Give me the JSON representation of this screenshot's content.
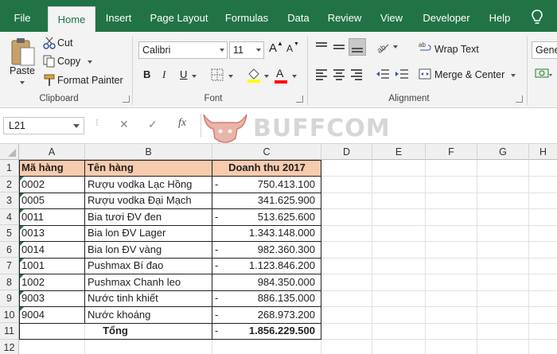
{
  "ribbon_tabs": [
    "File",
    "Home",
    "Insert",
    "Page Layout",
    "Formulas",
    "Data",
    "Review",
    "View",
    "Developer",
    "Help"
  ],
  "clipboard": {
    "paste": "Paste",
    "cut": "Cut",
    "copy": "Copy",
    "format_painter": "Format Painter",
    "label": "Clipboard"
  },
  "font": {
    "name": "Calibri",
    "size": "11",
    "bold": "B",
    "italic": "I",
    "underline": "U",
    "grow": "A",
    "shrink": "A",
    "font_color_letter": "A",
    "label": "Font",
    "fill_color": "#ffff00",
    "font_color": "#ff0000"
  },
  "alignment": {
    "wrap_text": "Wrap Text",
    "merge_center": "Merge & Center",
    "label": "Alignment"
  },
  "number": {
    "format": "Gene"
  },
  "formula_bar": {
    "name_box": "L21",
    "cancel": "✕",
    "enter": "✓",
    "fx": "fx",
    "value": ""
  },
  "watermark": {
    "text": "BUFFCOM"
  },
  "sheet": {
    "columns": [
      "A",
      "B",
      "C",
      "D",
      "E",
      "F",
      "G",
      "H"
    ],
    "rows": [
      "1",
      "2",
      "3",
      "4",
      "5",
      "6",
      "7",
      "8",
      "9",
      "10",
      "11",
      "12"
    ],
    "header": {
      "a": "Mã hàng",
      "b": "Tên hàng",
      "c": "Doanh thu 2017"
    },
    "data": [
      {
        "a": "0002",
        "b": "Rượu vodka Lạc Hồng",
        "dash": "-",
        "c": "750.413.100"
      },
      {
        "a": "0005",
        "b": "Rượu vodka Đại Mạch",
        "dash": "",
        "c": "341.625.900"
      },
      {
        "a": "0011",
        "b": "Bia tươi ĐV đen",
        "dash": "-",
        "c": "513.625.600"
      },
      {
        "a": "0013",
        "b": "Bia lon ĐV Lager",
        "dash": "",
        "c": "1.343.148.000"
      },
      {
        "a": "0014",
        "b": "Bia lon ĐV vàng",
        "dash": "-",
        "c": "982.360.300"
      },
      {
        "a": "1001",
        "b": "Pushmax Bí đao",
        "dash": "-",
        "c": "1.123.846.200"
      },
      {
        "a": "1002",
        "b": "Pushmax Chanh leo",
        "dash": "",
        "c": "984.350.000"
      },
      {
        "a": "9003",
        "b": "Nước tinh khiết",
        "dash": "-",
        "c": "886.135.000"
      },
      {
        "a": "9004",
        "b": "Nước khoáng",
        "dash": "-",
        "c": "268.973.200"
      }
    ],
    "total": {
      "label": "Tổng",
      "dash": "-",
      "value": "1.856.229.500"
    }
  },
  "colors": {
    "ribbon_green": "#217346",
    "header_fill": "#f8cbad",
    "error_indicator": "#1e7b3a"
  }
}
